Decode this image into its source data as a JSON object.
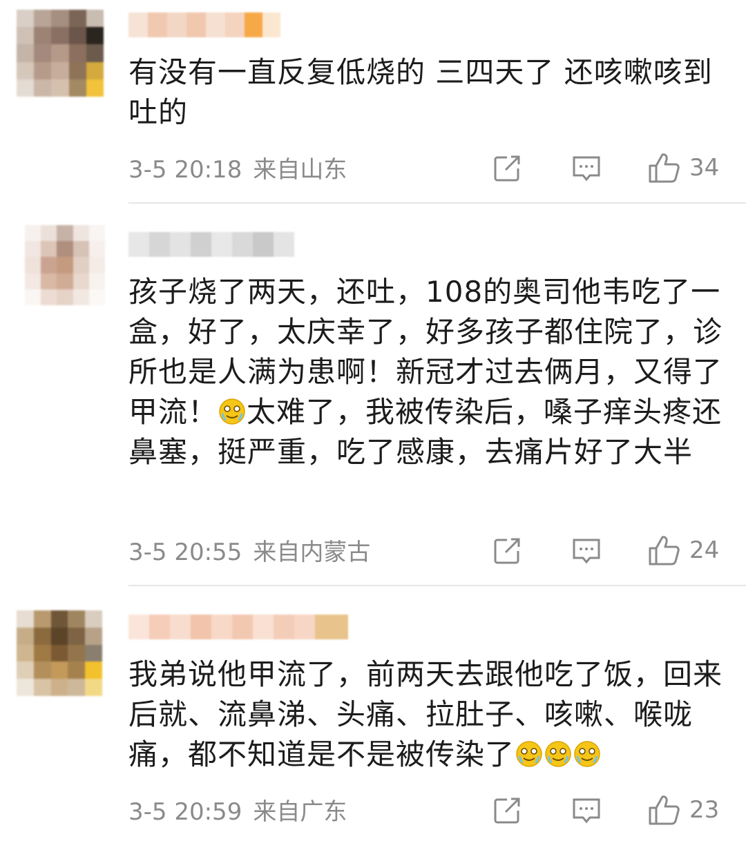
{
  "comments": [
    {
      "text": "有没有一直反复低烧的 三四天了 还咳嗽咳到吐的",
      "time": "3-5 20:18",
      "location": "来自山东",
      "likes": "34"
    },
    {
      "text_before_emoji": "孩子烧了两天，还吐，108的奥司他韦吃了一盒，好了，太庆幸了，好多孩子都住院了，诊所也是人满为患啊！新冠才过去俩月，又得了甲流！",
      "text_after_emoji": "太难了，我被传染后，嗓子痒头疼还鼻塞，挺严重，吃了感康，去痛片好了大半",
      "time": "3-5 20:55",
      "location": "来自内蒙古",
      "likes": "24"
    },
    {
      "text": "我弟说他甲流了，前两天去跟他吃了饭，回来后就、流鼻涕、头痛、拉肚子、咳嗽、喉咙痛，都不知道是不是被传染了",
      "time": "3-5 20:59",
      "location": "来自广东",
      "likes": "23"
    }
  ],
  "icons": {
    "share": "share-icon",
    "comment": "comment-icon",
    "like": "thumbs-up-icon",
    "emoji": "crying-laugh-emoji-icon"
  },
  "colors": {
    "meta_text": "#8a8a8a",
    "divider": "#e6e6e6",
    "emoji_yellow": "#f5c518"
  }
}
